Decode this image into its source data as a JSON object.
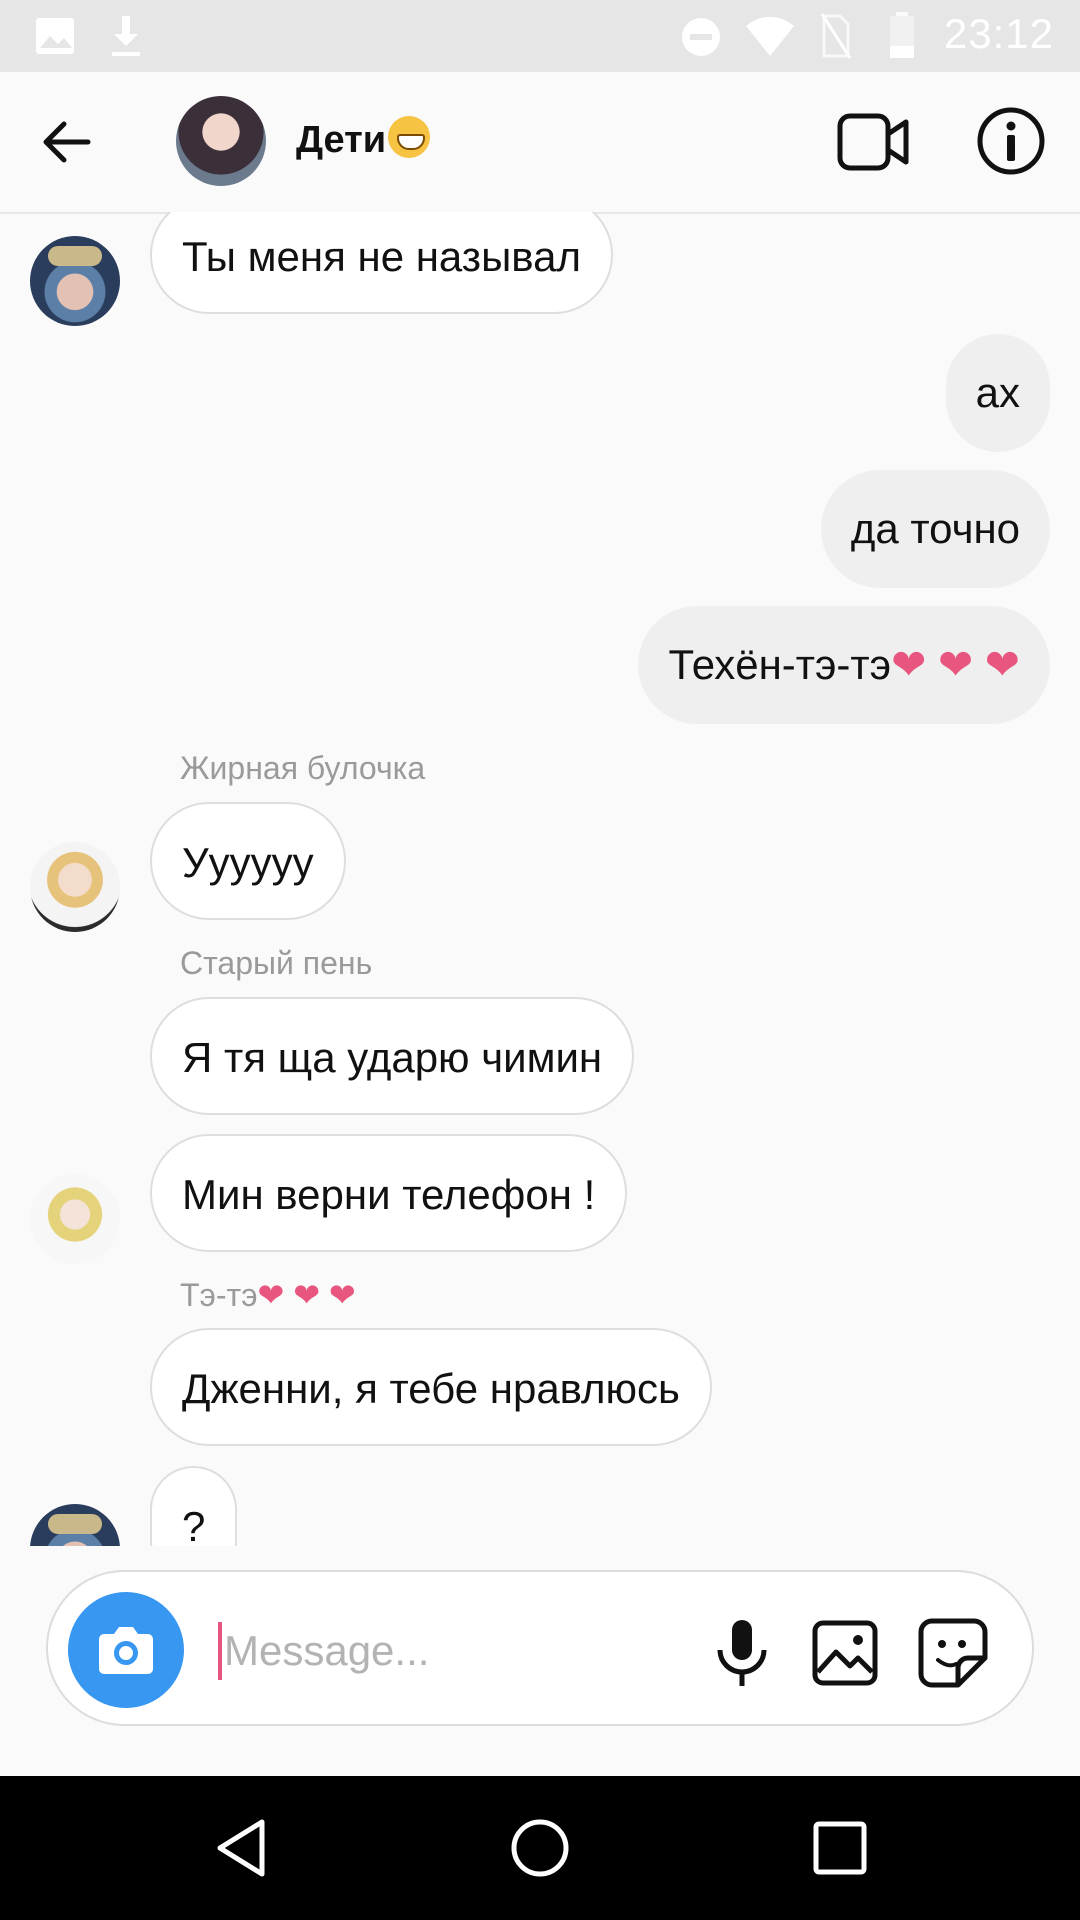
{
  "status_bar": {
    "time": "23:12",
    "icons": [
      "image-icon",
      "download-icon",
      "do-not-disturb-icon",
      "wifi-icon",
      "no-sim-icon",
      "battery-icon"
    ]
  },
  "header": {
    "title": "Дети",
    "icons": [
      "back-arrow-icon",
      "video-call-icon",
      "info-icon"
    ]
  },
  "messages": [
    {
      "type": "in",
      "text": "Ты меня не называл",
      "avatar": "v"
    },
    {
      "type": "out",
      "text": "ах"
    },
    {
      "type": "out",
      "text": "да точно"
    },
    {
      "type": "out",
      "text": "Техён-тэ-тэ",
      "suffix": "❤ ❤ ❤"
    },
    {
      "type": "sender",
      "text": "Жирная булочка"
    },
    {
      "type": "in",
      "text": "Уууууу",
      "avatar": "jimin"
    },
    {
      "type": "sender",
      "text": "Старый пень"
    },
    {
      "type": "in",
      "text": "Я тя ща ударю чимин"
    },
    {
      "type": "in",
      "text": "Мин верни телефон !",
      "avatar": "suga"
    },
    {
      "type": "sender",
      "text": "Тэ-тэ",
      "suffix": "❤ ❤ ❤"
    },
    {
      "type": "in",
      "text": "Дженни, я тебе нравлюсь"
    },
    {
      "type": "in",
      "text": "?",
      "avatar": "v"
    }
  ],
  "composer": {
    "placeholder": "Message...",
    "value": ""
  },
  "colors": {
    "accent_blue": "#3897f0",
    "heart_pink": "#e8567f",
    "outgoing_bubble": "#efefef",
    "incoming_bubble": "#ffffff"
  },
  "nav": [
    "back-triangle-icon",
    "home-circle-icon",
    "recents-square-icon"
  ]
}
